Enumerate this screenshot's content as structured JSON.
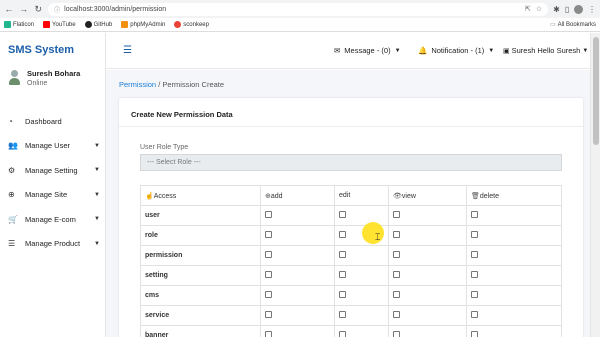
{
  "browser": {
    "url": "localhost:3000/admin/permission",
    "bookmarks": [
      {
        "label": "Flaticon",
        "color": "#1fb58f"
      },
      {
        "label": "YouTube",
        "color": "#ff0000"
      },
      {
        "label": "GitHub",
        "color": "#222222"
      },
      {
        "label": "phpMyAdmin",
        "color": "#f29111"
      },
      {
        "label": "sconkeep",
        "color": "#ea4335"
      }
    ],
    "all_bookmarks": "All Bookmarks"
  },
  "app": {
    "brand": "SMS System",
    "user": {
      "name": "Suresh Bohara",
      "status": "Online"
    },
    "menu": [
      {
        "label": "Dashboard",
        "icon": "dashboard-icon",
        "glyph": "◔",
        "has_children": false
      },
      {
        "label": "Manage User",
        "icon": "users-icon",
        "glyph": "👥",
        "has_children": true
      },
      {
        "label": "Manage Setting",
        "icon": "settings-icon",
        "glyph": "⚙",
        "has_children": true
      },
      {
        "label": "Manage Site",
        "icon": "globe-icon",
        "glyph": "⊕",
        "has_children": true
      },
      {
        "label": "Manage E-com",
        "icon": "cart-icon",
        "glyph": "🛒",
        "has_children": true
      },
      {
        "label": "Manage Product",
        "icon": "list-icon",
        "glyph": "☰",
        "has_children": true
      }
    ]
  },
  "topbar": {
    "message": "Message - (0)",
    "notification": "Notification - (1)",
    "user_alt": "Suresh",
    "user_greeting": "Hello Suresh"
  },
  "page": {
    "breadcrumb_link": "Permission",
    "breadcrumb_sep": "/",
    "breadcrumb_current": "Permission Create",
    "card_title": "Create New Permission Data",
    "role_label": "User Role Type",
    "role_placeholder": "--- Select Role ---",
    "table": {
      "headers": [
        {
          "label": "Access",
          "glyph": "☝"
        },
        {
          "label": "add",
          "glyph": "⊕"
        },
        {
          "label": "edit",
          "glyph": ""
        },
        {
          "label": "view",
          "glyph": "👁"
        },
        {
          "label": "delete",
          "glyph": "🗑"
        }
      ],
      "rows": [
        "user",
        "role",
        "permission",
        "setting",
        "cms",
        "service",
        "banner"
      ]
    }
  },
  "colors": {
    "brand": "#1c5fa8",
    "link": "#1c7ed6",
    "highlight": "#ffe01a"
  }
}
